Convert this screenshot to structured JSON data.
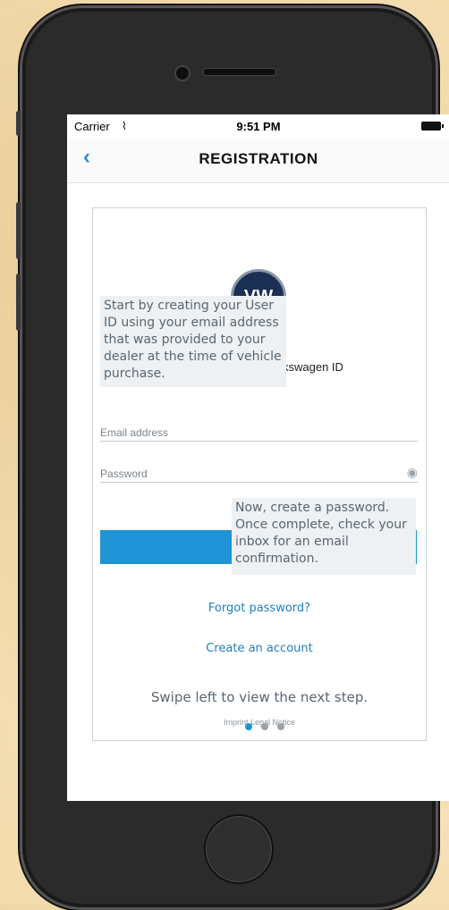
{
  "status_bar": {
    "carrier": "Carrier",
    "time": "9:51 PM"
  },
  "nav": {
    "back_icon": "chevron-left-icon",
    "title": "REGISTRATION"
  },
  "login": {
    "brand_label": "kswagen ID",
    "email_placeholder": "Email address",
    "password_placeholder": "Password",
    "forgot_password": "Forgot password?",
    "create_account": "Create an account",
    "footer": "Imprint  Legal Notice"
  },
  "tutorial": {
    "tip_user_id": "Start by creating your User ID using your email address that was provided to your dealer at the time of vehicle purchase.",
    "tip_password": "Now, create a password. Once complete, check your inbox for an email confirmation.",
    "swipe_hint": "Swipe left to view the next step.",
    "page_count": 3,
    "current_page": 1
  },
  "colors": {
    "accent": "#1f94d6",
    "link": "#1f7fc3",
    "nav_back": "#2a8cd4"
  }
}
